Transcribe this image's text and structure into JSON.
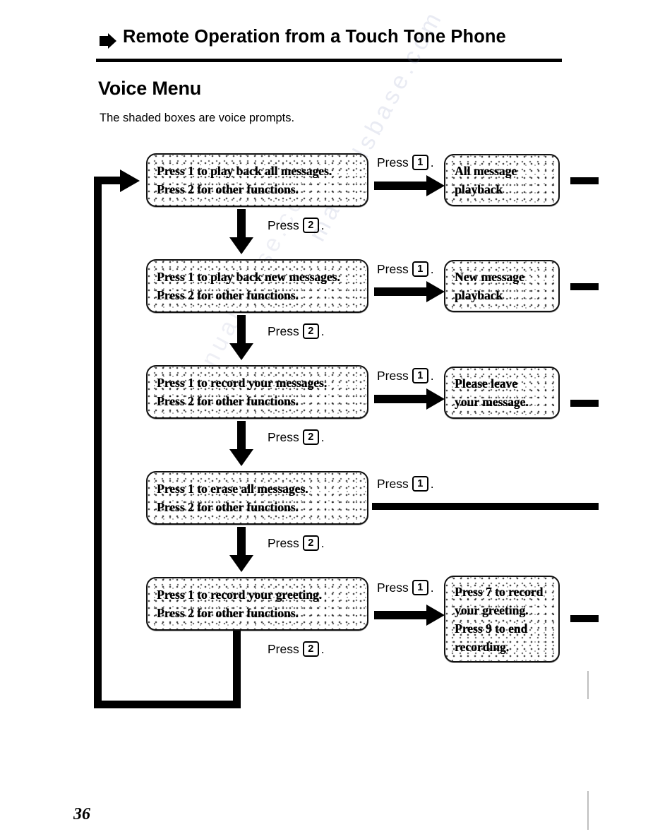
{
  "page": {
    "header_title": "Remote Operation from a Touch Tone Phone",
    "header_arrow_icon": "right-triangle-arrow",
    "section_title": "Voice Menu",
    "section_subtitle": "The shaded boxes are voice prompts.",
    "page_number": "36",
    "watermark_text": "manualsbase.com"
  },
  "flow": {
    "steps": [
      {
        "id": "all-messages",
        "prompt_line1": "Press 1 to play back all messages.",
        "prompt_line2": "Press 2 for other functions.",
        "branch_label_prefix": "Press",
        "branch_key": "1",
        "branch_label_suffix": ".",
        "next_label_prefix": "Press",
        "next_key": "2",
        "next_label_suffix": ".",
        "result_line1": "All message",
        "result_line2": "playback",
        "has_result_box": true
      },
      {
        "id": "new-messages",
        "prompt_line1": "Press 1 to play back new messages.",
        "prompt_line2": "Press 2 for other functions.",
        "branch_label_prefix": "Press",
        "branch_key": "1",
        "branch_label_suffix": ".",
        "next_label_prefix": "Press",
        "next_key": "2",
        "next_label_suffix": ".",
        "result_line1": "New message",
        "result_line2": "playback",
        "has_result_box": true
      },
      {
        "id": "record-message",
        "prompt_line1": "Press 1 to record your messages.",
        "prompt_line2": "Press 2 for other functions.",
        "branch_label_prefix": "Press",
        "branch_key": "1",
        "branch_label_suffix": ".",
        "next_label_prefix": "Press",
        "next_key": "2",
        "next_label_suffix": ".",
        "result_line1": "Please leave",
        "result_line2": "your message.",
        "has_result_box": true
      },
      {
        "id": "erase-all-messages",
        "prompt_line1": "Press 1 to erase all messages.",
        "prompt_line2": "Press 2 for other functions.",
        "branch_label_prefix": "Press",
        "branch_key": "1",
        "branch_label_suffix": ".",
        "next_label_prefix": "Press",
        "next_key": "2",
        "next_label_suffix": ".",
        "has_result_box": false
      },
      {
        "id": "record-greeting",
        "prompt_line1": "Press 1 to record your greeting.",
        "prompt_line2": "Press 2 for other functions.",
        "branch_label_prefix": "Press",
        "branch_key": "1",
        "branch_label_suffix": ".",
        "next_label_prefix": "Press",
        "next_key": "2",
        "next_label_suffix": ".",
        "result_line1": "Press 7 to record",
        "result_line2": "your greeting.",
        "result_line3": "Press 9 to end",
        "result_line4": "recording.",
        "has_result_box": true
      }
    ]
  },
  "colors": {
    "ink": "#000000",
    "paper": "#ffffff"
  }
}
